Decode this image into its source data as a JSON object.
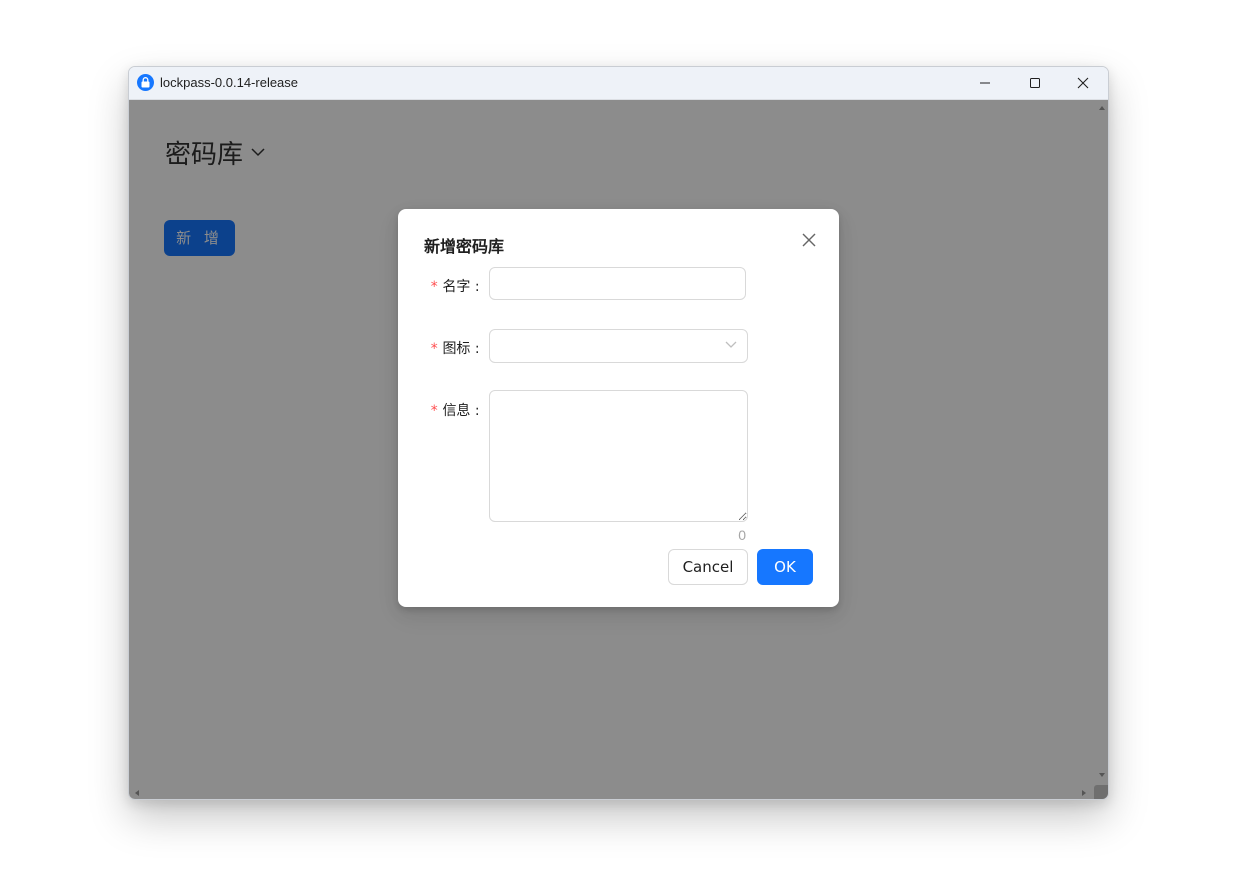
{
  "window": {
    "title": "lockpass-0.0.14-release",
    "icons": {
      "app": "lock-icon",
      "minimize": "minimize-icon",
      "maximize": "maximize-icon",
      "close": "close-icon"
    }
  },
  "page": {
    "vault_title": "密码库",
    "vault_dropdown_icon": "chevron-down-icon",
    "add_button_label": "新 增"
  },
  "modal": {
    "title": "新增密码库",
    "close_icon": "close-icon",
    "required_mark": "*",
    "fields": {
      "name": {
        "label": "名字",
        "value": ""
      },
      "icon": {
        "label": "图标",
        "value": "",
        "dropdown_icon": "chevron-down-icon"
      },
      "info": {
        "label": "信息",
        "value": "",
        "char_count": "0"
      }
    },
    "colon": ":",
    "buttons": {
      "cancel": "Cancel",
      "ok": "OK"
    }
  },
  "colors": {
    "primary": "#1677ff",
    "required": "#ff4d4f",
    "overlay": "rgba(0,0,0,0.45)"
  }
}
